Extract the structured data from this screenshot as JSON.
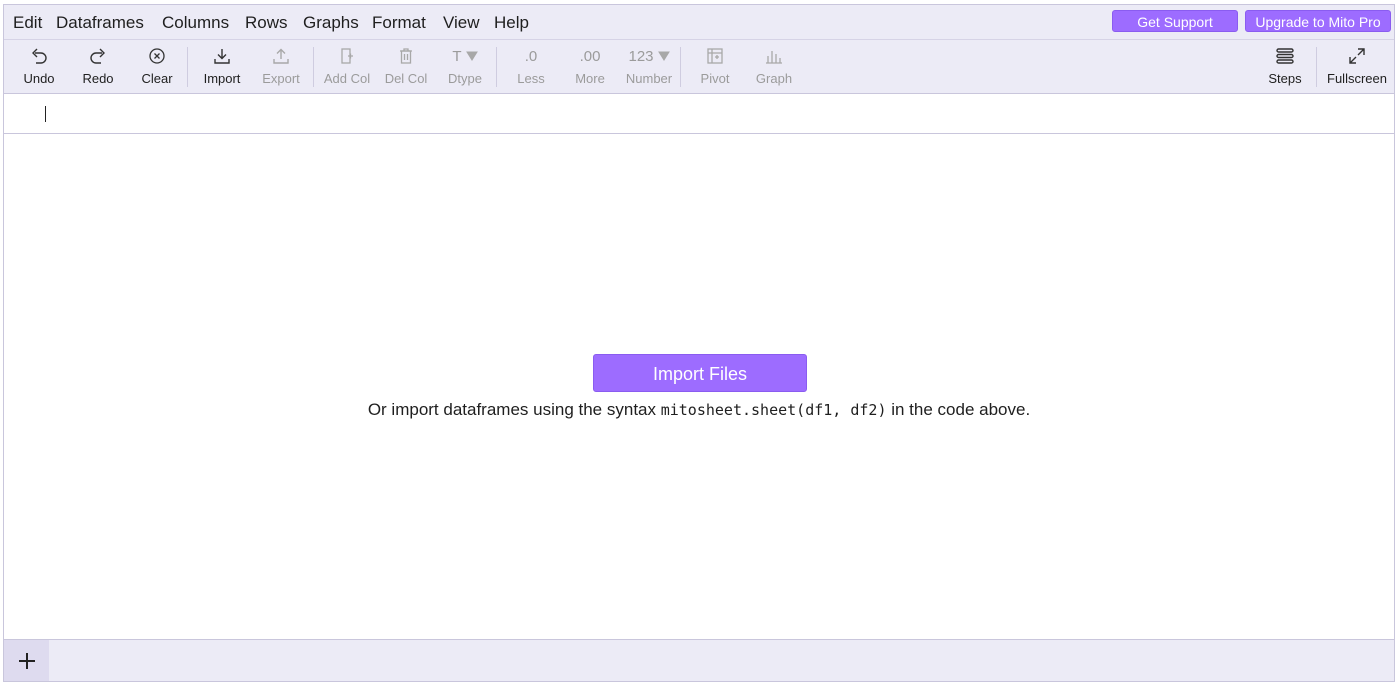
{
  "menu": [
    "Edit",
    "Dataframes",
    "Columns",
    "Rows",
    "Graphs",
    "Format",
    "View",
    "Help"
  ],
  "top_buttons": {
    "support": "Get Support",
    "upgrade": "Upgrade to Mito Pro"
  },
  "toolbar": {
    "undo": "Undo",
    "redo": "Redo",
    "clear": "Clear",
    "import": "Import",
    "export": "Export",
    "add_col": "Add Col",
    "del_col": "Del Col",
    "dtype": "Dtype",
    "less": "Less",
    "more": "More",
    "number": "Number",
    "pivot": "Pivot",
    "graph": "Graph",
    "steps": "Steps",
    "fullscreen": "Fullscreen",
    "less_glyph": ".0",
    "more_glyph": ".00",
    "number_glyph": "123",
    "dtype_glyph": "T"
  },
  "empty_state": {
    "button": "Import Files",
    "hint_before": "Or import dataframes using the syntax ",
    "hint_code": "mitosheet.sheet(df1, df2)",
    "hint_after": " in the code above."
  },
  "colors": {
    "accent": "#9d6cff",
    "bar_bg": "#ecebf6",
    "border": "#c9c6dc"
  },
  "icons": {
    "undo": "undo-icon",
    "redo": "redo-icon",
    "clear": "clear-icon",
    "import": "download-icon",
    "export": "upload-icon",
    "add_col": "add-column-icon",
    "del_col": "trash-icon",
    "pivot": "pivot-icon",
    "graph": "bar-chart-icon",
    "steps": "steps-icon",
    "fullscreen": "fullscreen-icon",
    "add_sheet": "plus-icon"
  }
}
